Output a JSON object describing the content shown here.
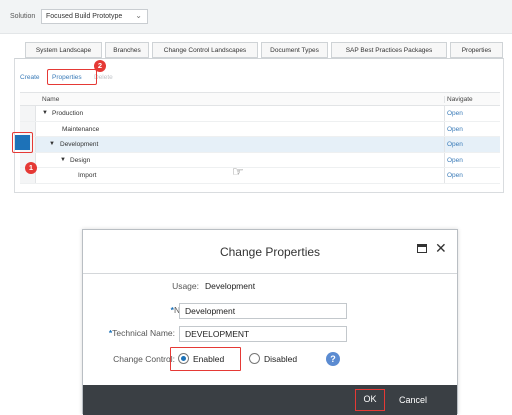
{
  "solution_bar": {
    "label": "Solution",
    "selected": "Focused Build Prototype"
  },
  "tabs": [
    {
      "label": "System Landscape"
    },
    {
      "label": "Branches"
    },
    {
      "label": "Change Control Landscapes"
    },
    {
      "label": "Document Types"
    },
    {
      "label": "SAP Best Practices Packages"
    },
    {
      "label": "Properties"
    }
  ],
  "toolbar": {
    "create": "Create",
    "properties": "Properties",
    "delete": "Delete"
  },
  "grid": {
    "headers": {
      "name": "Name",
      "navigate": "Navigate"
    },
    "rows": [
      {
        "name": "Production",
        "open": "Open",
        "expanded": true,
        "level": 0
      },
      {
        "name": "Maintenance",
        "open": "Open",
        "level": 1
      },
      {
        "name": "Development",
        "open": "Open",
        "expanded": true,
        "level": 0,
        "selected": true
      },
      {
        "name": "Design",
        "open": "Open",
        "expanded": true,
        "level": 1
      },
      {
        "name": "Import",
        "open": "Open",
        "level": 2
      }
    ]
  },
  "annotations": {
    "step1": "1",
    "step2": "2"
  },
  "dialog": {
    "title": "Change Properties",
    "usage_label": "Usage:",
    "usage_value": "Development",
    "name_label": "Name:",
    "name_value": "Development",
    "tech_name_label": "Technical Name:",
    "tech_name_value": "DEVELOPMENT",
    "change_control_label": "Change Control:",
    "enabled_label": "Enabled",
    "disabled_label": "Disabled",
    "ok_label": "OK",
    "cancel_label": "Cancel"
  },
  "colors": {
    "accent": "#1d72b8",
    "highlight": "#e53935",
    "footer": "#3a3f44"
  }
}
